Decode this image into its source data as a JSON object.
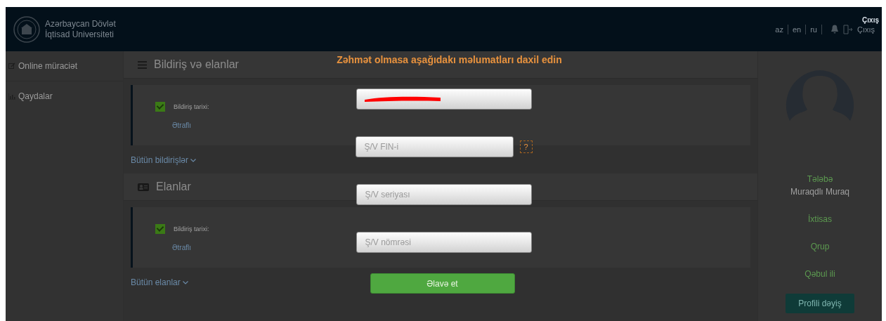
{
  "header": {
    "logo_title": "Azərbaycan Dövlət",
    "logo_subtitle": "İqtisad Universiteti",
    "languages": [
      "az",
      "en",
      "ru"
    ],
    "exit_label": "Çıxış",
    "exit_tooltip": "Çıxış"
  },
  "sidebar": {
    "items": [
      {
        "label": "Online müraciət"
      },
      {
        "label": "Qaydalar"
      }
    ]
  },
  "sections": [
    {
      "title": "Bildiriş və elanlar",
      "cards": [
        {
          "label": "Bildiriş tarixi:",
          "checked": true,
          "link": "Ətraflı"
        }
      ],
      "more": "Bütün bildirişlər"
    },
    {
      "title": "Elanlar",
      "cards": [
        {
          "label": "Bildiriş tarixi:",
          "checked": true,
          "link": "Ətraflı"
        }
      ],
      "more": "Bütün elanlar"
    }
  ],
  "profile": {
    "role": "Tələbə",
    "name": "Muraqdlı Muraq",
    "fields": [
      "İxtisas",
      "Qrup",
      "Qəbul ili"
    ],
    "button": "Profili dəyiş"
  },
  "modal": {
    "title": "Zəhmət olmasa aşağıdakı məlumatları daxil edin",
    "fields": [
      {
        "kind": "redacted"
      },
      {
        "kind": "help",
        "placeholder": "Ş/V FIN-i",
        "help": "?"
      },
      {
        "kind": "plain",
        "placeholder": "Ş/V seriyası"
      },
      {
        "kind": "plain",
        "placeholder": "Ş/V nömrəsi"
      }
    ],
    "submit": "Əlavə et"
  }
}
